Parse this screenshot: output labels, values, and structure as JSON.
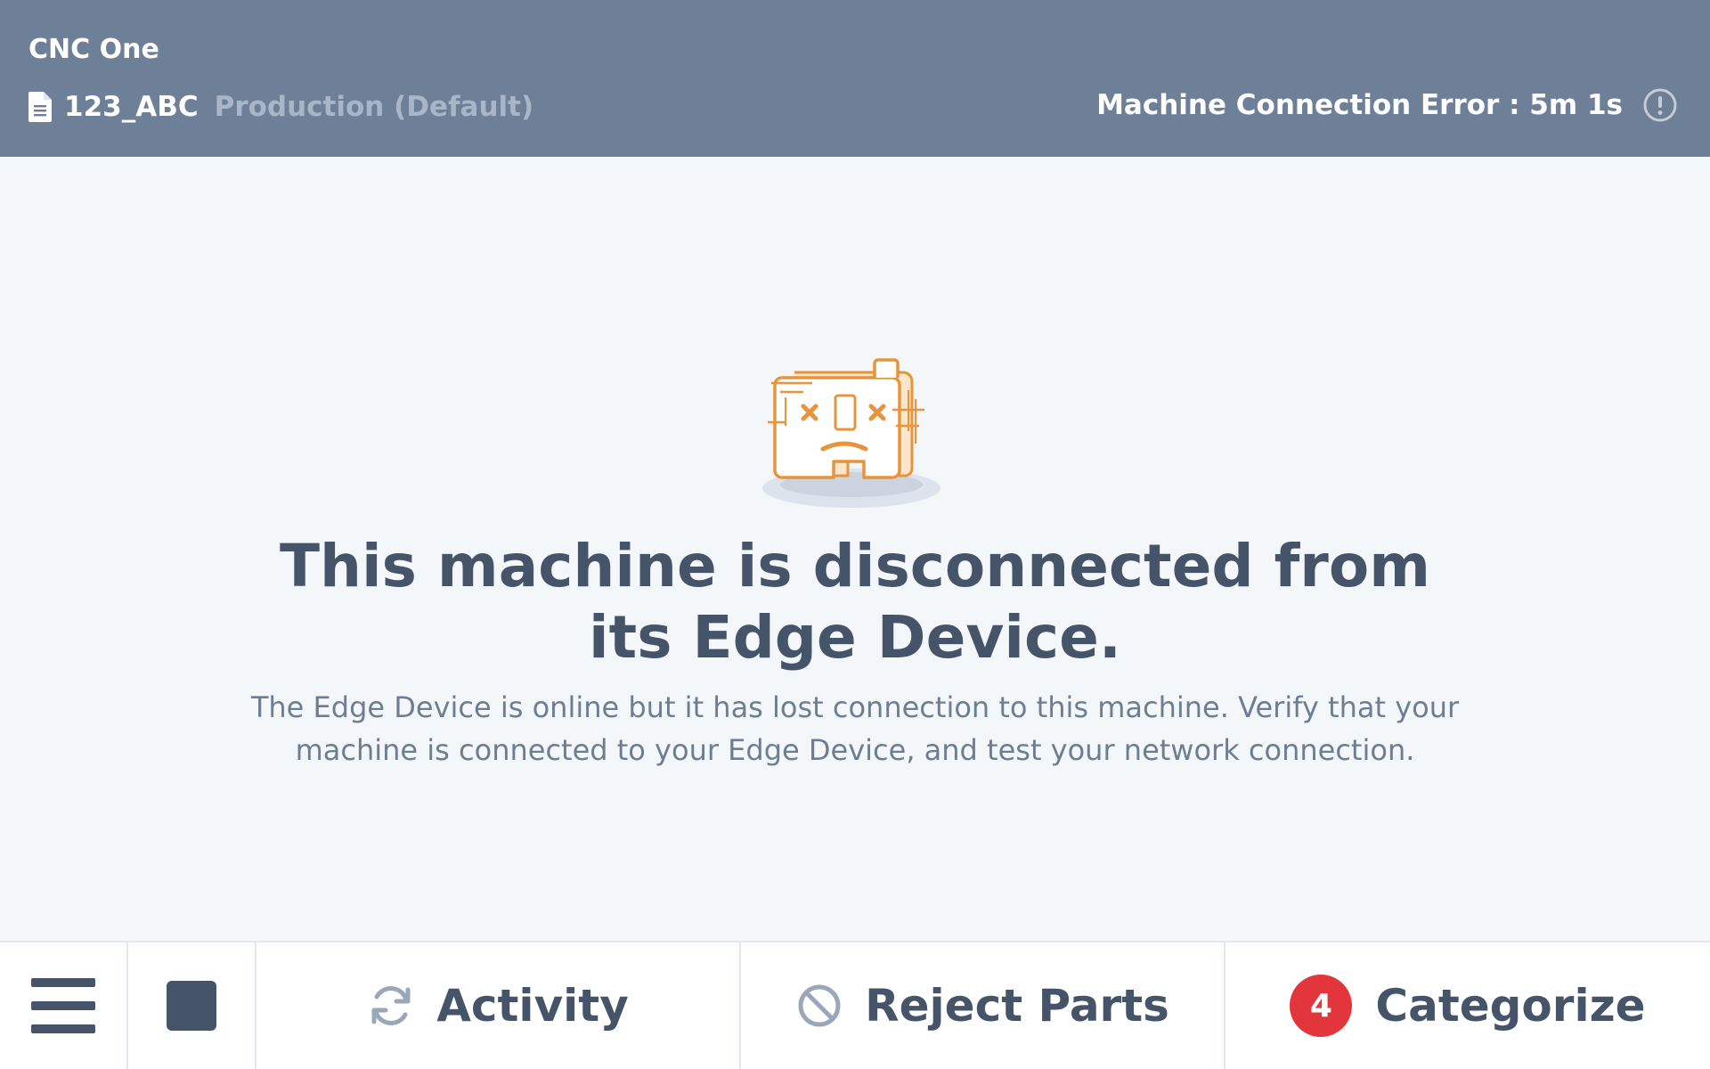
{
  "header": {
    "machine_name": "CNC One",
    "job_id": "123_ABC",
    "job_mode": "Production (Default)",
    "status_text": "Machine Connection Error : 5m 1s",
    "status_icon": "alert-circle-icon",
    "job_icon": "document-icon"
  },
  "main": {
    "illustration": "disconnected-machine-illustration",
    "headline": "This machine is disconnected from its Edge Device.",
    "description": "The Edge Device is online but it has lost connection to this machine. Verify that your machine is connected to your Edge Device, and test your network connection."
  },
  "bottom_bar": {
    "menu_icon": "hamburger-menu-icon",
    "stop_icon": "stop-icon",
    "activity_label": "Activity",
    "activity_icon": "refresh-icon",
    "reject_label": "Reject Parts",
    "reject_icon": "prohibited-icon",
    "categorize_label": "Categorize",
    "categorize_count": "4"
  },
  "colors": {
    "header_bg": "#6e7f98",
    "page_bg": "#f4f7fa",
    "text_dark": "#46546a",
    "text_muted": "#6e7d92",
    "illustration_orange": "#e8943c",
    "badge_red": "#e3363c"
  }
}
